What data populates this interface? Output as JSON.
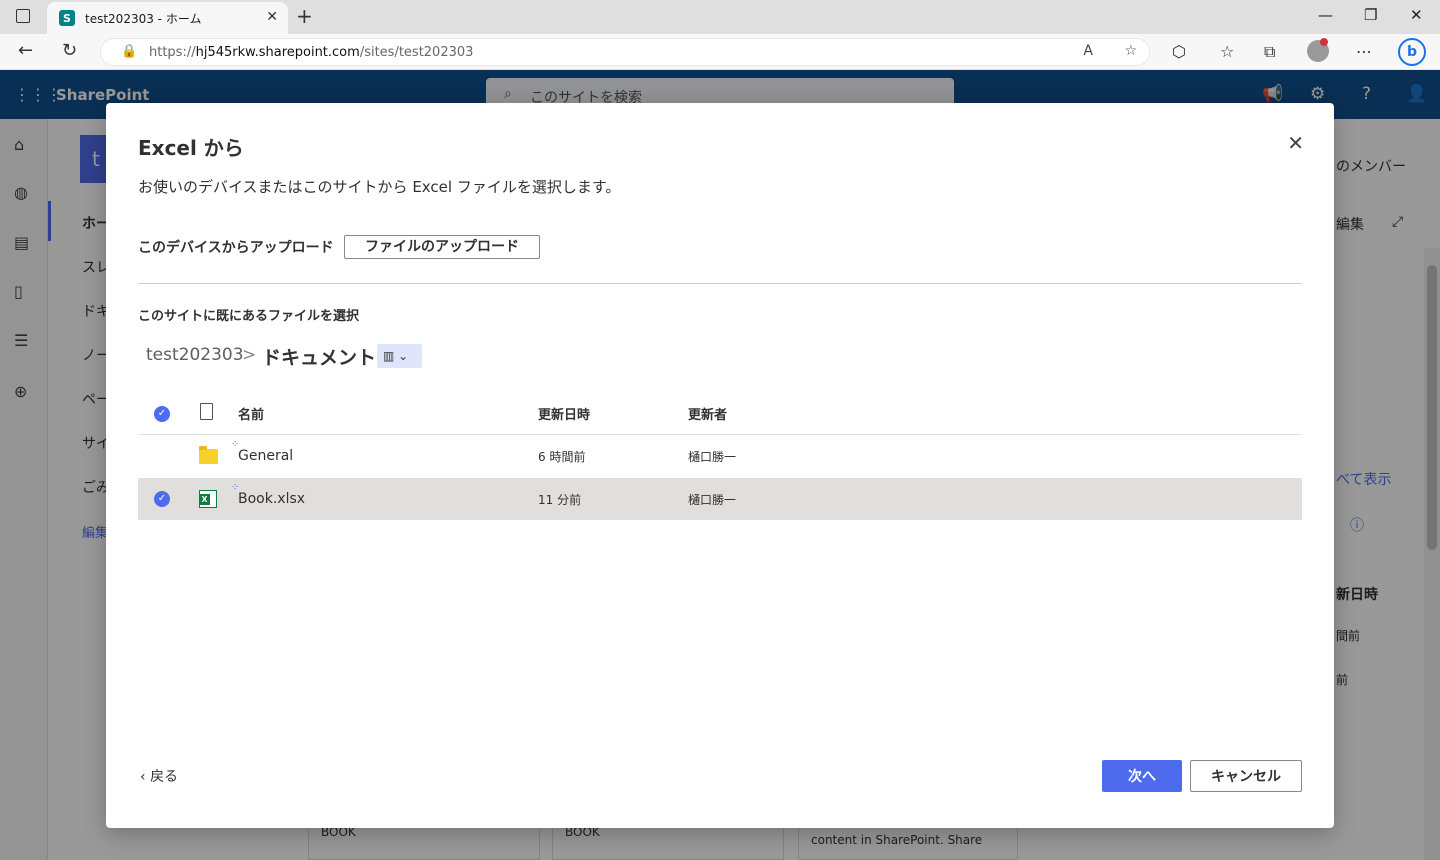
{
  "browser": {
    "tab_title": "test202303 - ホーム",
    "tab_favicon_letter": "S",
    "url_scheme": "https://",
    "url_host": "hj545rkw.sharepoint.com",
    "url_path": "/sites/test202303",
    "new_tab_glyph": "+",
    "close_glyph": "✕"
  },
  "sharepoint": {
    "brand": "SharePoint",
    "search_placeholder": "このサイトを検索",
    "site_logo_letter": "t",
    "nav_items": [
      "ホーム",
      "スレッド",
      "ドキュメント",
      "ノートブック",
      "ページ",
      "サイト コンテンツ",
      "ごみ箱"
    ],
    "nav_edit": "編集",
    "right_members": "のメンバー",
    "right_edit": "編集",
    "right_see_all": "べて表示",
    "right_col_header": "新日時",
    "right_row1": "間前",
    "right_row2": "前",
    "card1": "BOOK",
    "card2": "BOOK",
    "card3": "content in SharePoint. Share"
  },
  "dialog": {
    "title": "Excel から",
    "description": "お使いのデバイスまたはこのサイトから Excel ファイルを選択します。",
    "upload_label": "このデバイスからアップロード",
    "upload_button": "ファイルのアップロード",
    "select_label": "このサイトに既にあるファイルを選択",
    "breadcrumb_site": "test202303",
    "breadcrumb_separator": ">",
    "breadcrumb_library": "ドキュメント",
    "columns": {
      "name": "名前",
      "modified": "更新日時",
      "modified_by": "更新者"
    },
    "files": [
      {
        "type": "folder",
        "name": "General",
        "modified": "6 時間前",
        "modified_by": "樋口勝一",
        "selected": false,
        "icon": "folder-icon"
      },
      {
        "type": "xlsx",
        "name": "Book.xlsx",
        "modified": "11 分前",
        "modified_by": "樋口勝一",
        "selected": true,
        "icon": "excel-file-icon"
      }
    ],
    "back": "戻る",
    "next": "次へ",
    "cancel": "キャンセル"
  },
  "colors": {
    "suite_bar": "#104f8c",
    "accent": "#4f6bed",
    "selected_row": "#e1dfdd"
  }
}
